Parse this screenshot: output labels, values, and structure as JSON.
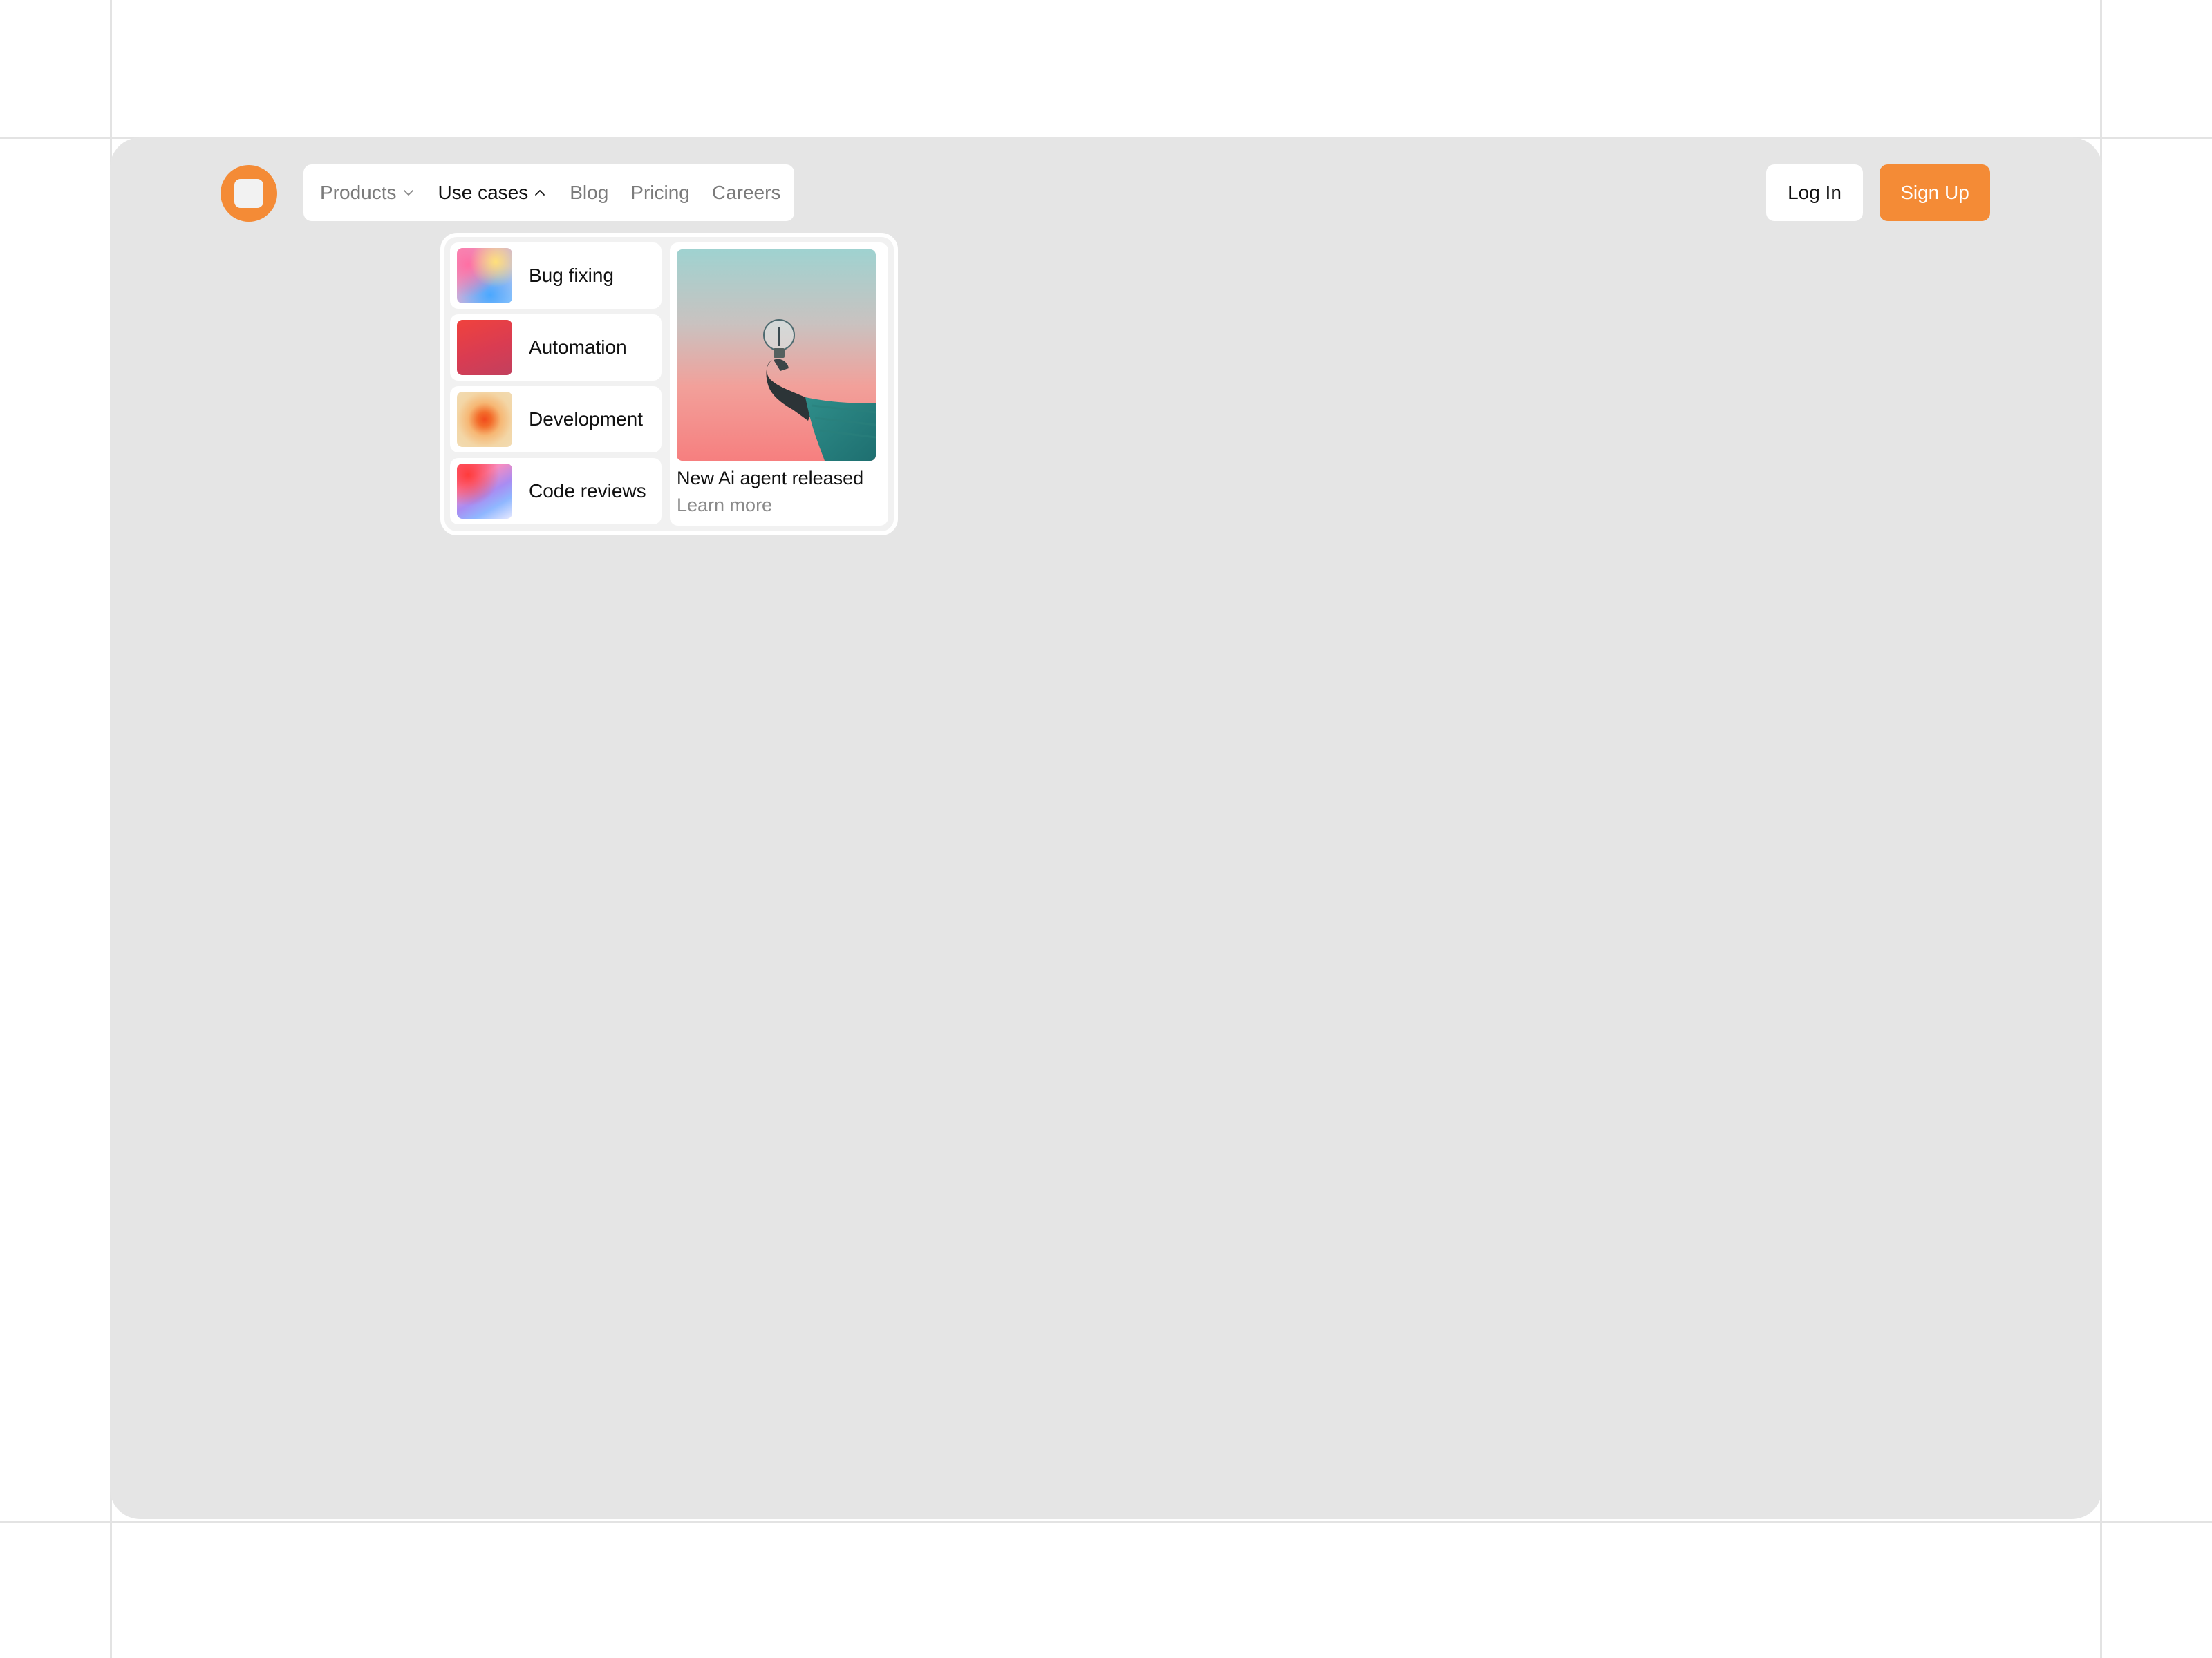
{
  "nav": {
    "items": [
      {
        "label": "Products"
      },
      {
        "label": "Use cases"
      },
      {
        "label": "Blog"
      },
      {
        "label": "Pricing"
      },
      {
        "label": "Careers"
      }
    ]
  },
  "auth": {
    "login_label": "Log In",
    "signup_label": "Sign Up"
  },
  "dropdown": {
    "items": [
      {
        "label": "Bug fixing",
        "icon": "gradient-thumbnail"
      },
      {
        "label": "Automation",
        "icon": "gradient-thumbnail"
      },
      {
        "label": "Development",
        "icon": "gradient-thumbnail"
      },
      {
        "label": "Code reviews",
        "icon": "gradient-thumbnail"
      }
    ],
    "card": {
      "title": "New Ai agent released",
      "link": "Learn more",
      "image": "hand-holding-lightbulb-photo"
    }
  },
  "colors": {
    "accent": "#f48b36",
    "frame_bg": "#e5e5e5",
    "page_bg": "#ffffff"
  }
}
